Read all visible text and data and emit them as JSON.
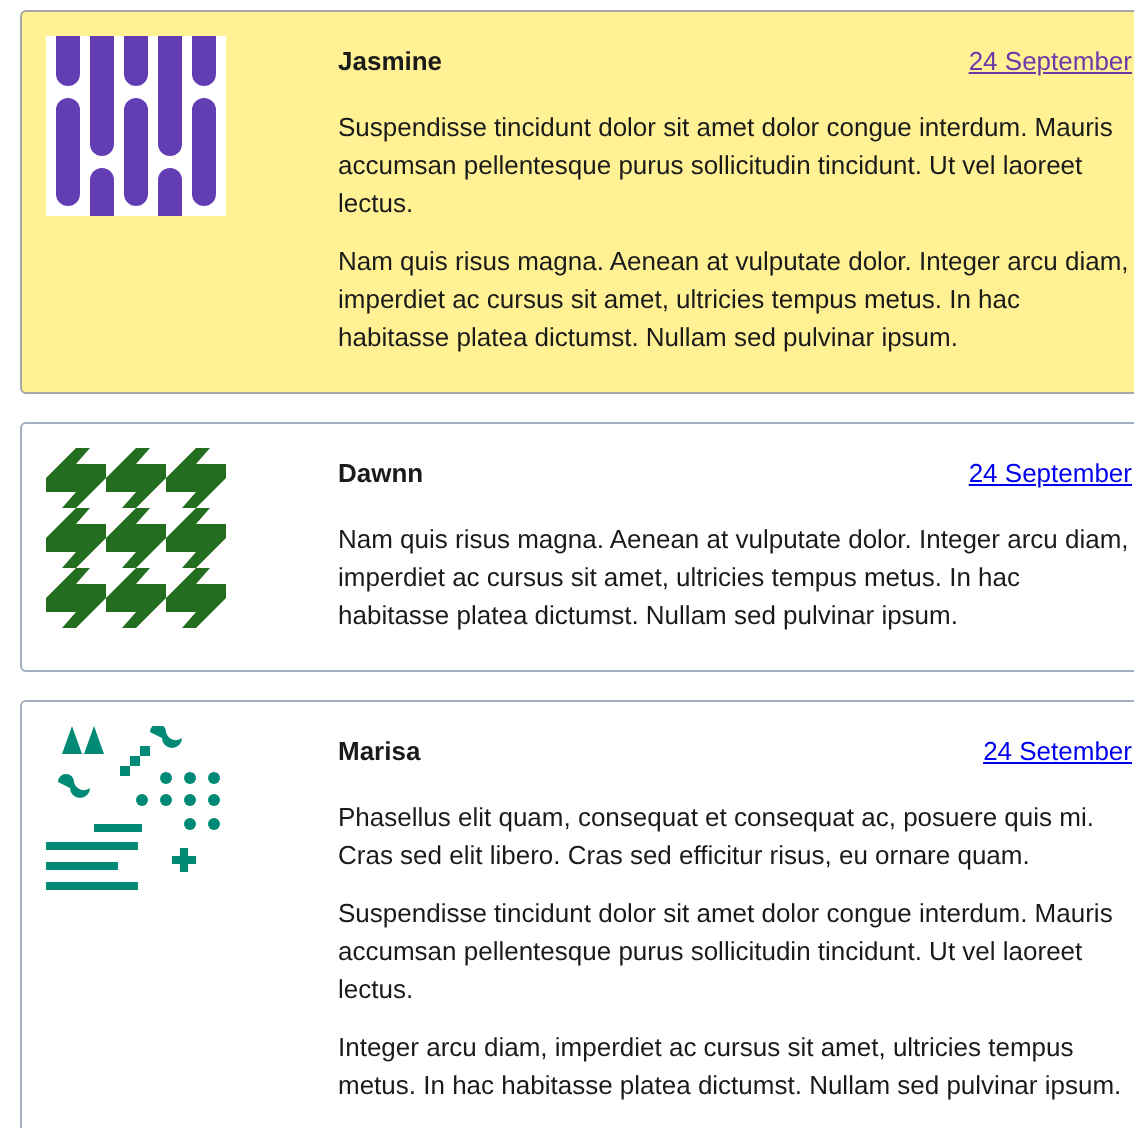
{
  "cards": [
    {
      "name": "Jasmine",
      "date": "24 September",
      "visited": true,
      "highlighted": true,
      "kind": "stripes",
      "paragraphs": [
        "Suspendisse tincidunt dolor sit amet dolor congue interdum. Mauris accumsan pellentesque purus sollicitudin tincidunt. Ut vel laoreet lectus.",
        "Nam quis risus magna. Aenean at vulputate dolor. Integer arcu diam, imperdiet ac cursus sit amet, ultricies tempus metus. In hac habitasse platea dictumst. Nullam sed pulvinar ipsum."
      ]
    },
    {
      "name": "Dawnn",
      "date": "24 September",
      "visited": false,
      "highlighted": false,
      "kind": "houndstooth",
      "paragraphs": [
        "Nam quis risus magna. Aenean at vulputate dolor. Integer arcu diam, imperdiet ac cursus sit amet, ultricies tempus metus. In hac habitasse platea dictumst. Nullam sed pulvinar ipsum."
      ]
    },
    {
      "name": "Marisa",
      "date": "24 Setember",
      "visited": false,
      "highlighted": false,
      "kind": "shapes",
      "paragraphs": [
        "Phasellus elit quam, consequat et consequat ac, posuere quis mi. Cras sed elit libero. Cras sed efficitur risus, eu ornare quam.",
        "Suspendisse tincidunt dolor sit amet dolor congue interdum. Mauris accumsan pellentesque purus sollicitudin tincidunt. Ut vel laoreet lectus.",
        "Integer arcu diam, imperdiet ac cursus sit amet, ultricies tempus metus. In hac habitasse platea dictumst. Nullam sed pulvinar ipsum."
      ]
    }
  ]
}
